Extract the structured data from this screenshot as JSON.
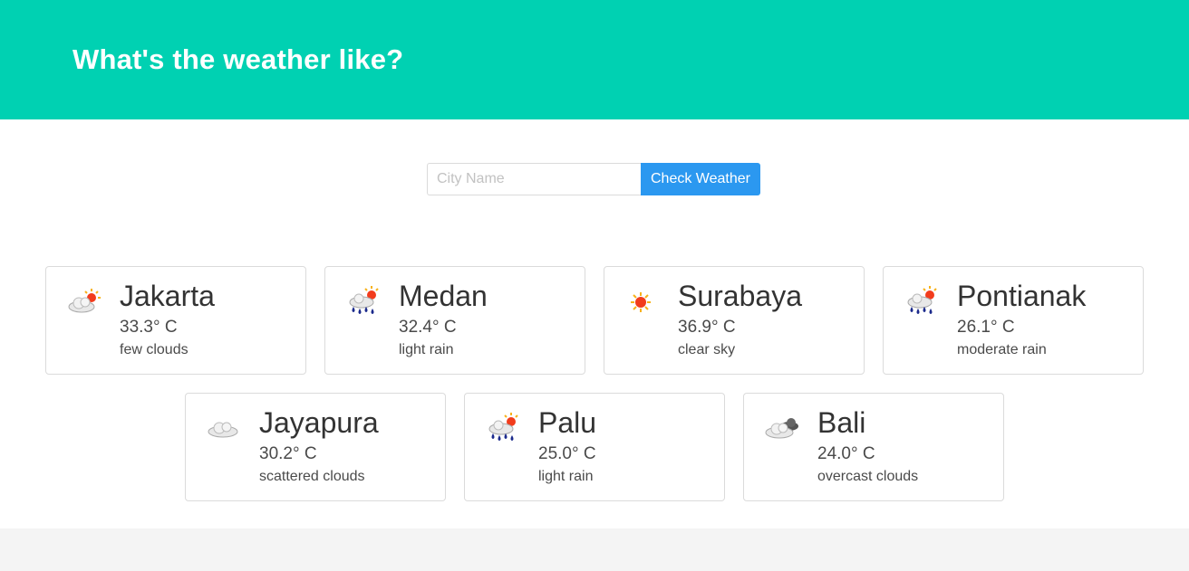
{
  "header": {
    "title": "What's the weather like?"
  },
  "search": {
    "placeholder": "City Name",
    "value": "",
    "button_label": "Check Weather"
  },
  "cards": [
    {
      "city": "Jakarta",
      "temp": "33.3° C",
      "desc": "few clouds",
      "icon": "few-clouds-icon"
    },
    {
      "city": "Medan",
      "temp": "32.4° C",
      "desc": "light rain",
      "icon": "rain-icon"
    },
    {
      "city": "Surabaya",
      "temp": "36.9° C",
      "desc": "clear sky",
      "icon": "sun-icon"
    },
    {
      "city": "Pontianak",
      "temp": "26.1° C",
      "desc": "moderate rain",
      "icon": "rain-icon"
    },
    {
      "city": "Jayapura",
      "temp": "30.2° C",
      "desc": "scattered clouds",
      "icon": "cloud-icon"
    },
    {
      "city": "Palu",
      "temp": "25.0° C",
      "desc": "light rain",
      "icon": "rain-icon"
    },
    {
      "city": "Bali",
      "temp": "24.0° C",
      "desc": "overcast clouds",
      "icon": "overcast-clouds-icon"
    }
  ],
  "colors": {
    "accent": "#00d1b2",
    "button": "#2b98f0",
    "border": "#dbdbdb",
    "footer": "#f4f4f4"
  }
}
